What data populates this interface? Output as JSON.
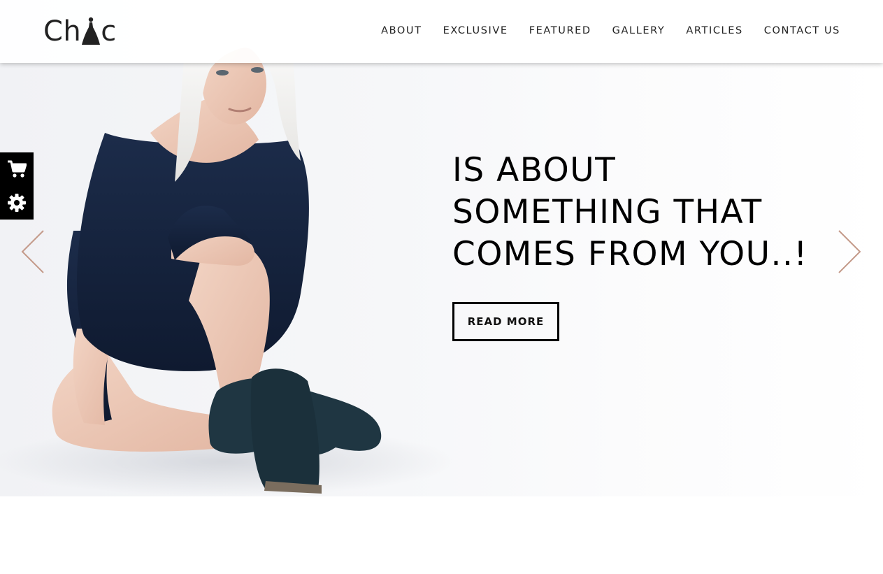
{
  "header": {
    "logo_text_start": "Ch",
    "logo_text_end": "c",
    "nav": [
      {
        "label": "ABOUT"
      },
      {
        "label": "EXCLUSIVE"
      },
      {
        "label": "FEATURED"
      },
      {
        "label": "GALLERY"
      },
      {
        "label": "ARTICLES"
      },
      {
        "label": "CONTACT US"
      }
    ]
  },
  "side_widget": {
    "icons": [
      "shopping-cart-icon",
      "gear-icon"
    ]
  },
  "slider": {
    "heading_lines": [
      "IS ABOUT",
      "SOMETHING THAT",
      "COMES FROM YOU..!"
    ],
    "button_label": "READ MORE",
    "arrow_color": "#c49a8a"
  },
  "colors": {
    "text": "#000000",
    "accent": "#c49a8a",
    "widget_bg": "#000000"
  }
}
